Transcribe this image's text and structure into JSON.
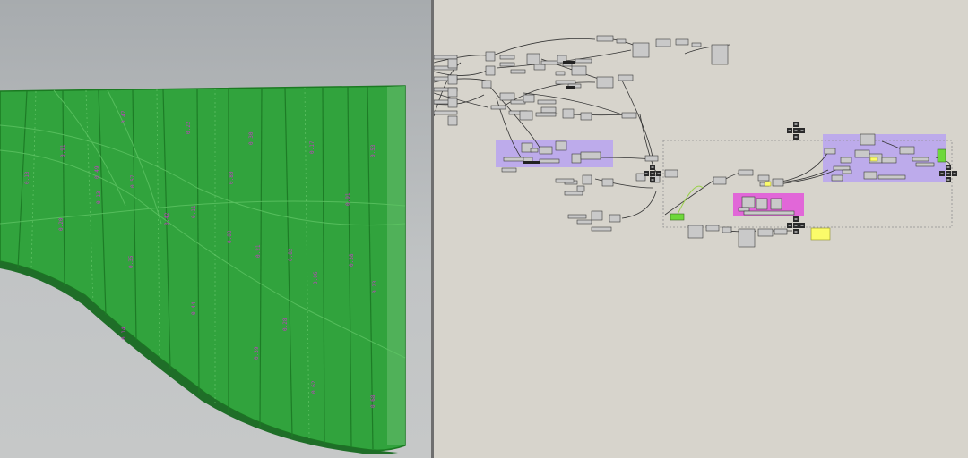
{
  "app": {
    "left_pane": "rhino-viewport",
    "right_pane": "grasshopper-canvas"
  },
  "colors": {
    "surface_fill": "#2fa43b",
    "surface_edge": "#1b7a22",
    "surface_dark": "#1f6e28",
    "text_dot": "#c03fc0",
    "group_purple": "#b8a3f0",
    "group_pink": "#e25bd9",
    "canvas_bg": "#d7d4cc",
    "wire": "#3a3a3a",
    "wire_selected": "#9ad04c",
    "toggle_green": "#6ed83a",
    "panel_yellow": "#fbfb6a"
  },
  "viewport": {
    "text_dot_labels": [
      "0.47",
      "0.22",
      "0.91",
      "0.13",
      "0.13",
      "0.57",
      "0.30",
      "0.17",
      "0.53",
      "0.20",
      "0.42",
      "0.11",
      "0.03",
      "0.35",
      "0.21",
      "0.82",
      "0.38",
      "0.06",
      "0.23",
      "0.44",
      "0.39",
      "0.62",
      "0.68",
      "0.14",
      "0.49",
      "0.80",
      "0.91",
      "0.28"
    ]
  },
  "canvas": {
    "icons": [
      "zoom-cluster-icon",
      "zoom-cluster-icon",
      "zoom-cluster-icon",
      "zoom-cluster-icon"
    ]
  }
}
